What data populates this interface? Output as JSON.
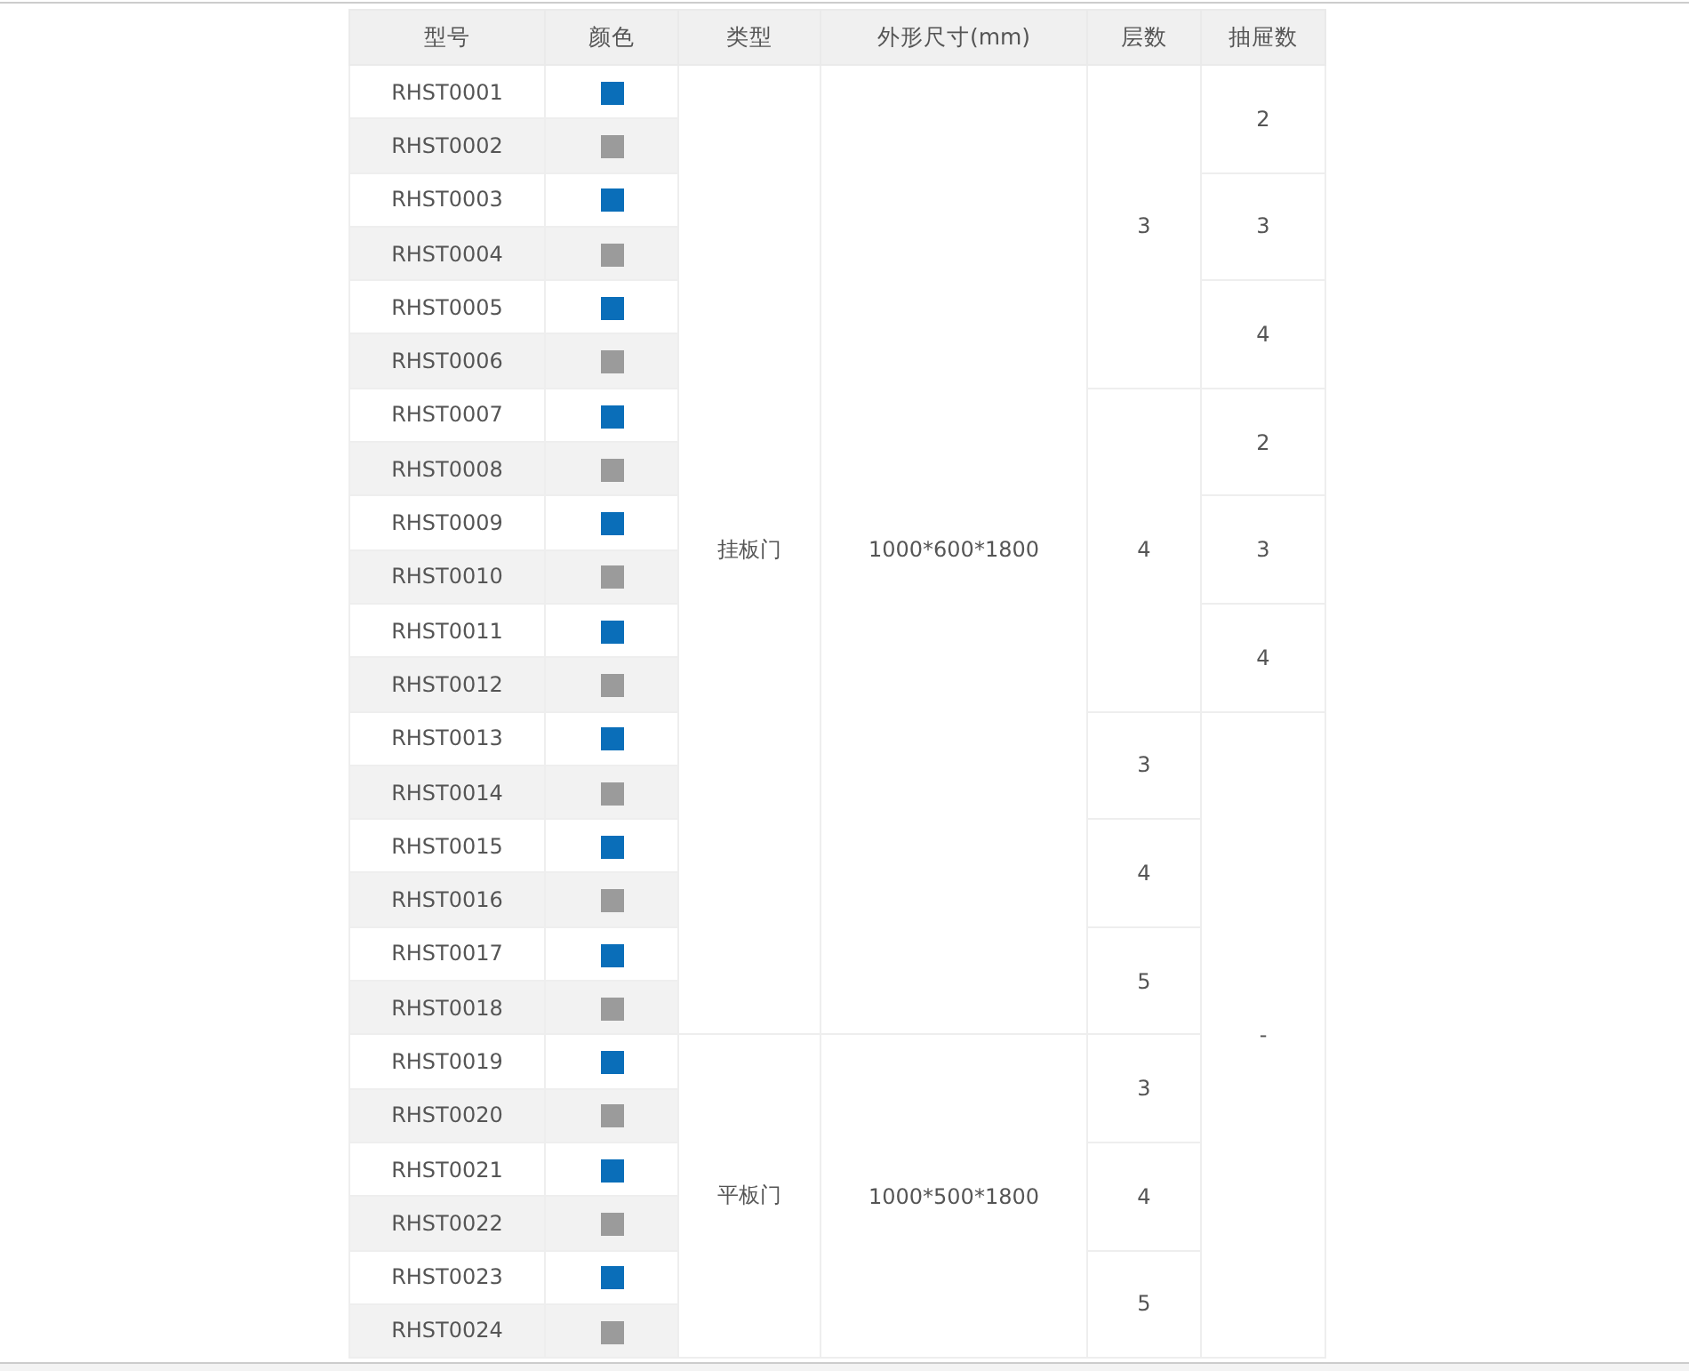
{
  "table": {
    "columns": [
      "型号",
      "颜色",
      "类型",
      "外形尺寸(mm)",
      "层数",
      "抽屉数"
    ],
    "rows": [
      {
        "model": "RHST0001",
        "color": "#0a6eb9",
        "type": "挂板门",
        "size": "1000*600*1800",
        "layers": "3",
        "drawers": "2"
      },
      {
        "model": "RHST0002",
        "color": "#9b9b9b"
      },
      {
        "model": "RHST0003",
        "color": "#0a6eb9",
        "drawers": "3"
      },
      {
        "model": "RHST0004",
        "color": "#9b9b9b"
      },
      {
        "model": "RHST0005",
        "color": "#0a6eb9",
        "drawers": "4"
      },
      {
        "model": "RHST0006",
        "color": "#9b9b9b"
      },
      {
        "model": "RHST0007",
        "color": "#0a6eb9",
        "layers": "4",
        "drawers": "2"
      },
      {
        "model": "RHST0008",
        "color": "#9b9b9b"
      },
      {
        "model": "RHST0009",
        "color": "#0a6eb9",
        "drawers": "3"
      },
      {
        "model": "RHST0010",
        "color": "#9b9b9b"
      },
      {
        "model": "RHST0011",
        "color": "#0a6eb9",
        "drawers": "4"
      },
      {
        "model": "RHST0012",
        "color": "#9b9b9b"
      },
      {
        "model": "RHST0013",
        "color": "#0a6eb9",
        "layers": "3",
        "drawers": "-"
      },
      {
        "model": "RHST0014",
        "color": "#9b9b9b"
      },
      {
        "model": "RHST0015",
        "color": "#0a6eb9",
        "layers": "4"
      },
      {
        "model": "RHST0016",
        "color": "#9b9b9b"
      },
      {
        "model": "RHST0017",
        "color": "#0a6eb9",
        "layers": "5"
      },
      {
        "model": "RHST0018",
        "color": "#9b9b9b"
      },
      {
        "model": "RHST0019",
        "color": "#0a6eb9",
        "type": "平板门",
        "size": "1000*500*1800",
        "layers": "3"
      },
      {
        "model": "RHST0020",
        "color": "#9b9b9b"
      },
      {
        "model": "RHST0021",
        "color": "#0a6eb9",
        "layers": "4"
      },
      {
        "model": "RHST0022",
        "color": "#9b9b9b"
      },
      {
        "model": "RHST0023",
        "color": "#0a6eb9",
        "layers": "5"
      },
      {
        "model": "RHST0024",
        "color": "#9b9b9b"
      }
    ]
  }
}
